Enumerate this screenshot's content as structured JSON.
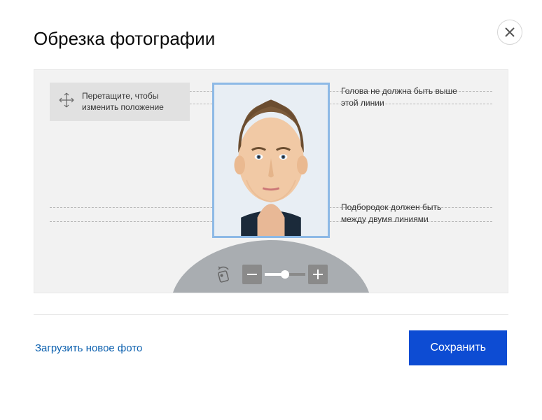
{
  "title": "Обрезка фотографии",
  "hints": {
    "drag": "Перетащите, чтобы изменить положение",
    "head_line": "Голова не должна быть выше этой линии",
    "chin_line": "Подбородок должен быть между двумя линиями"
  },
  "footer": {
    "upload_new": "Загрузить новое фото",
    "save": "Сохранить"
  },
  "icons": {
    "close": "close-icon",
    "move": "move-arrows-icon",
    "rotate": "rotate-icon",
    "zoom_out": "minus-icon",
    "zoom_in": "plus-icon"
  },
  "colors": {
    "primary": "#0d4cd3",
    "link": "#0d61af",
    "frame": "#8db9e6"
  }
}
